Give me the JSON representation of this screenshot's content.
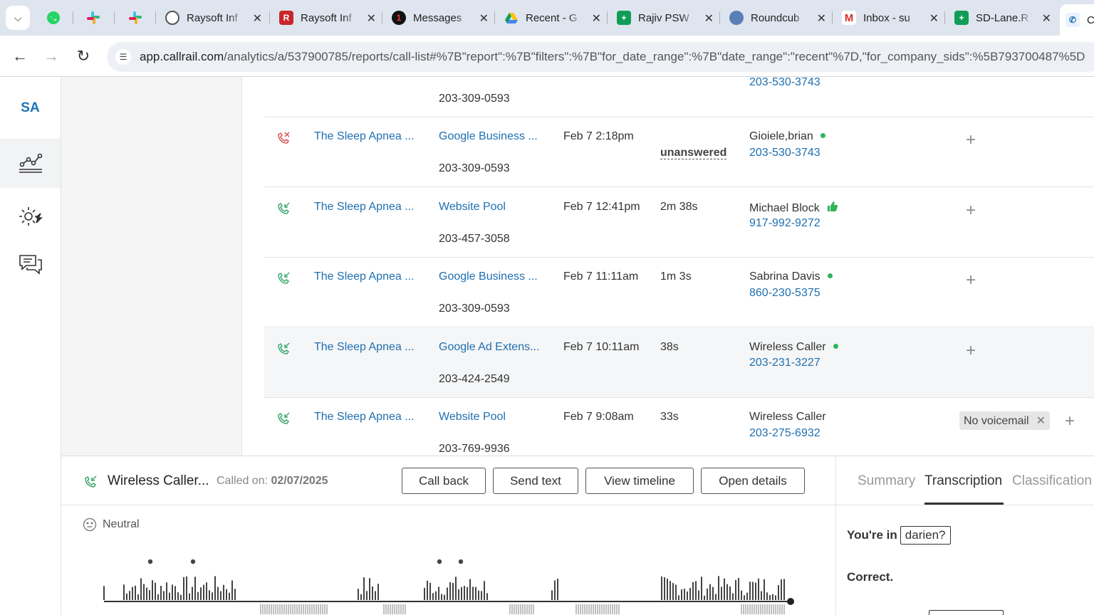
{
  "browser": {
    "tabs": [
      {
        "title": "Raysoft Inf",
        "icon": "globe-icon"
      },
      {
        "title": "Raysoft Inf",
        "icon": "raysoft-icon"
      },
      {
        "title": "Messages",
        "icon": "messages-icon"
      },
      {
        "title": "Recent - G",
        "icon": "drive-icon"
      },
      {
        "title": "Rajiv PSW",
        "icon": "sheets-icon"
      },
      {
        "title": "Roundcub",
        "icon": "roundcube-icon"
      },
      {
        "title": "Inbox - su",
        "icon": "gmail-icon"
      },
      {
        "title": "SD-Lane.R",
        "icon": "sheets-icon"
      },
      {
        "title": "C",
        "icon": "callrail-icon"
      }
    ],
    "url_host": "app.callrail.com",
    "url_path": "/analytics/a/537900785/reports/call-list#%7B\"report\":%7B\"filters\":%7B\"for_date_range\":%7B\"date_range\":\"recent\"%7D,\"for_company_sids\":%5B793700487%5D"
  },
  "rail": {
    "logo": "SA",
    "items": [
      "analytics-icon",
      "settings-icon",
      "conversations-icon"
    ]
  },
  "partial_row": {
    "tracking": "203-309-0593",
    "caller_phone": "203-530-3743"
  },
  "rows": [
    {
      "direction": "missed",
      "company": "The Sleep Apnea ...",
      "source": "Google Business ...",
      "tracking": "203-309-0593",
      "time": "Feb 7 2:18pm",
      "duration": "unanswered",
      "caller": "Gioiele,brian",
      "caller_phone": "203-530-3743",
      "marker": "green-dot"
    },
    {
      "direction": "inbound",
      "company": "The Sleep Apnea ...",
      "source": "Website Pool",
      "tracking": "203-457-3058",
      "time": "Feb 7 12:41pm",
      "duration": "2m 38s",
      "caller": "Michael Block",
      "caller_phone": "917-992-9272",
      "marker": "thumbs-up"
    },
    {
      "direction": "inbound",
      "company": "The Sleep Apnea ...",
      "source": "Google Business ...",
      "tracking": "203-309-0593",
      "time": "Feb 7 11:11am",
      "duration": "1m 3s",
      "caller": "Sabrina Davis",
      "caller_phone": "860-230-5375",
      "marker": "green-dot"
    },
    {
      "direction": "inbound",
      "company": "The Sleep Apnea ...",
      "source": "Google Ad Extens...",
      "tracking": "203-424-2549",
      "time": "Feb 7 10:11am",
      "duration": "38s",
      "caller": "Wireless Caller",
      "caller_phone": "203-231-3227",
      "marker": "green-dot"
    },
    {
      "direction": "inbound",
      "company": "The Sleep Apnea ...",
      "source": "Website Pool",
      "tracking": "203-769-9936",
      "time": "Feb 7 9:08am",
      "duration": "33s",
      "caller": "Wireless Caller",
      "caller_phone": "203-275-6932",
      "marker": "none",
      "tag": "No voicemail"
    }
  ],
  "detail": {
    "caller": "Wireless Caller...",
    "called_on_label": "Called on:",
    "called_on_date": "02/07/2025",
    "buttons": {
      "call_back": "Call back",
      "send_text": "Send text",
      "view_timeline": "View timeline",
      "open_details": "Open details"
    },
    "sentiment": "Neutral",
    "tabs": {
      "summary": "Summary",
      "transcription": "Transcription",
      "classification": "Classification"
    },
    "transcript": {
      "line1_prefix": "You're in",
      "line1_box": "darien?",
      "line2": "Correct."
    }
  },
  "colors": {
    "link": "#1f6fb0",
    "missed": "#d9534f",
    "inbound": "#3aa76d",
    "dot": "#2fb45a"
  }
}
